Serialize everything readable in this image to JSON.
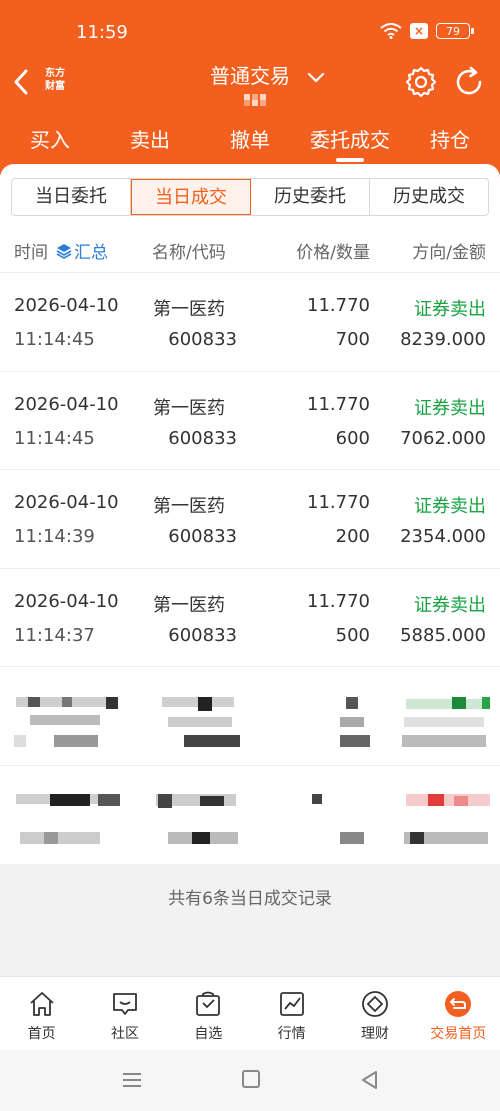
{
  "status": {
    "time": "11:59",
    "battery": "79"
  },
  "header": {
    "logo_line1": "东方",
    "logo_line2": "财富",
    "title": "普通交易"
  },
  "tabs": [
    {
      "label": "买入"
    },
    {
      "label": "卖出"
    },
    {
      "label": "撤单"
    },
    {
      "label": "委托成交",
      "active": true
    },
    {
      "label": "持仓"
    }
  ],
  "segments": [
    {
      "label": "当日委托"
    },
    {
      "label": "当日成交",
      "active": true
    },
    {
      "label": "历史委托"
    },
    {
      "label": "历史成交"
    }
  ],
  "columns": {
    "time": "时间",
    "summary": "汇总",
    "name_code": "名称/代码",
    "price_qty": "价格/数量",
    "dir_amount": "方向/金额"
  },
  "trades": [
    {
      "date": "2026-04-10",
      "time": "11:14:45",
      "name": "第一医药",
      "code": "600833",
      "price": "11.770",
      "qty": "700",
      "direction": "证券卖出",
      "amount": "8239.000"
    },
    {
      "date": "2026-04-10",
      "time": "11:14:45",
      "name": "第一医药",
      "code": "600833",
      "price": "11.770",
      "qty": "600",
      "direction": "证券卖出",
      "amount": "7062.000"
    },
    {
      "date": "2026-04-10",
      "time": "11:14:39",
      "name": "第一医药",
      "code": "600833",
      "price": "11.770",
      "qty": "200",
      "direction": "证券卖出",
      "amount": "2354.000"
    },
    {
      "date": "2026-04-10",
      "time": "11:14:37",
      "name": "第一医药",
      "code": "600833",
      "price": "11.770",
      "qty": "500",
      "direction": "证券卖出",
      "amount": "5885.000"
    }
  ],
  "footer": {
    "summary": "共有6条当日成交记录"
  },
  "bottom_nav": [
    {
      "label": "首页",
      "icon": "home-icon"
    },
    {
      "label": "社区",
      "icon": "chat-icon"
    },
    {
      "label": "自选",
      "icon": "bag-icon"
    },
    {
      "label": "行情",
      "icon": "chart-icon"
    },
    {
      "label": "理财",
      "icon": "diamond-icon"
    },
    {
      "label": "交易首页",
      "icon": "exchange-icon",
      "active": true
    }
  ],
  "colors": {
    "brand": "#f25f1e",
    "sell_green": "#1aa344",
    "link_blue": "#2a7ed8"
  }
}
